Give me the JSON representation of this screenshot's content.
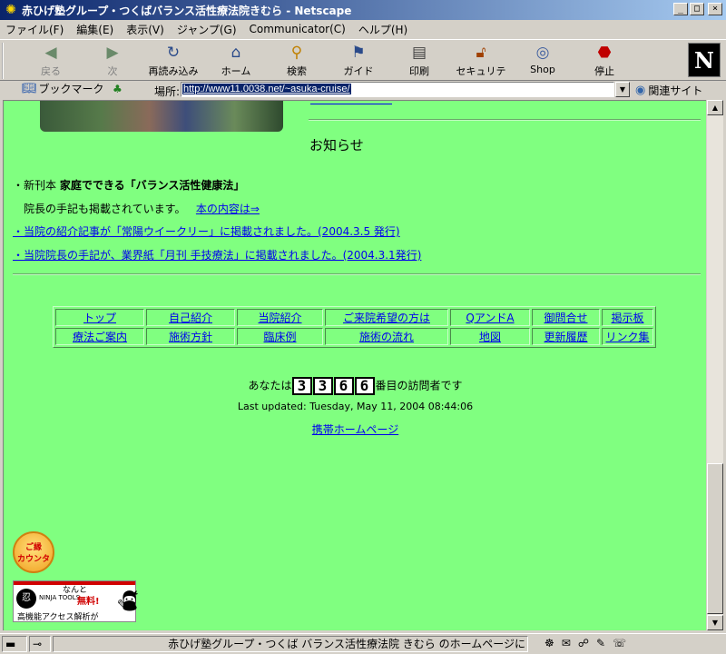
{
  "window": {
    "title": "赤ひげ塾グループ・つくばバランス活性療法院きむら - Netscape",
    "controls": [
      "_",
      "□",
      "×"
    ]
  },
  "menu": [
    "ファイル(F)",
    "編集(E)",
    "表示(V)",
    "ジャンプ(G)",
    "Communicator(C)",
    "ヘルプ(H)"
  ],
  "toolbar": {
    "back": "戻る",
    "forward": "次",
    "reload": "再読み込み",
    "home": "ホーム",
    "search": "検索",
    "guide": "ガイド",
    "print": "印刷",
    "security": "セキュリティ",
    "shop": "Shop",
    "stop": "停止",
    "logo": "N"
  },
  "location": {
    "bookmarks_label": "ブックマーク",
    "location_label": "場所:",
    "url": "http://www11.0038.net/~asuka-cruise/",
    "related_label": "関連サイト"
  },
  "content": {
    "heading": "お知らせ",
    "news1_prefix": "・新刊本 ",
    "news1_title": "家庭でできる「バランス活性健康法」",
    "news1_body": "院長の手記も掲載されています。",
    "news1_link": "本の内容は⇒",
    "news2_link": "・当院の紹介記事が「常陽ウイークリー」に掲載されました。(2004.3.5 発行)",
    "news3_link": "・当院院長の手記が、業界紙「月刊 手技療法」に掲載されました。(2004.3.1発行)",
    "nav_rows": [
      [
        "トップ",
        "自己紹介",
        "当院紹介",
        "ご来院希望の方は",
        "QアンドA",
        "御問合せ",
        "掲示板"
      ],
      [
        "療法ご案内",
        "施術方針",
        "臨床例",
        "施術の流れ",
        "地図",
        "更新履歴",
        "リンク集"
      ]
    ],
    "counter_prefix": "あなたは",
    "counter_digits": [
      "3",
      "3",
      "6",
      "6"
    ],
    "counter_suffix": "番目の訪問者です",
    "last_updated": "Last updated: Tuesday, May 11, 2004 08:44:06",
    "mobile_link": "携帯ホームページ",
    "badge_line1": "ご縁",
    "badge_line2": "カウンタ",
    "ninja_naNto": "なんと",
    "ninja_free": "無料!",
    "ninja_brand": "NINJA TOOLS",
    "ninja_caption": "高機能アクセス解析が"
  },
  "status": {
    "message": "赤ひげ塾グループ・つくば バランス活性療法院 きむら のホームページに"
  }
}
